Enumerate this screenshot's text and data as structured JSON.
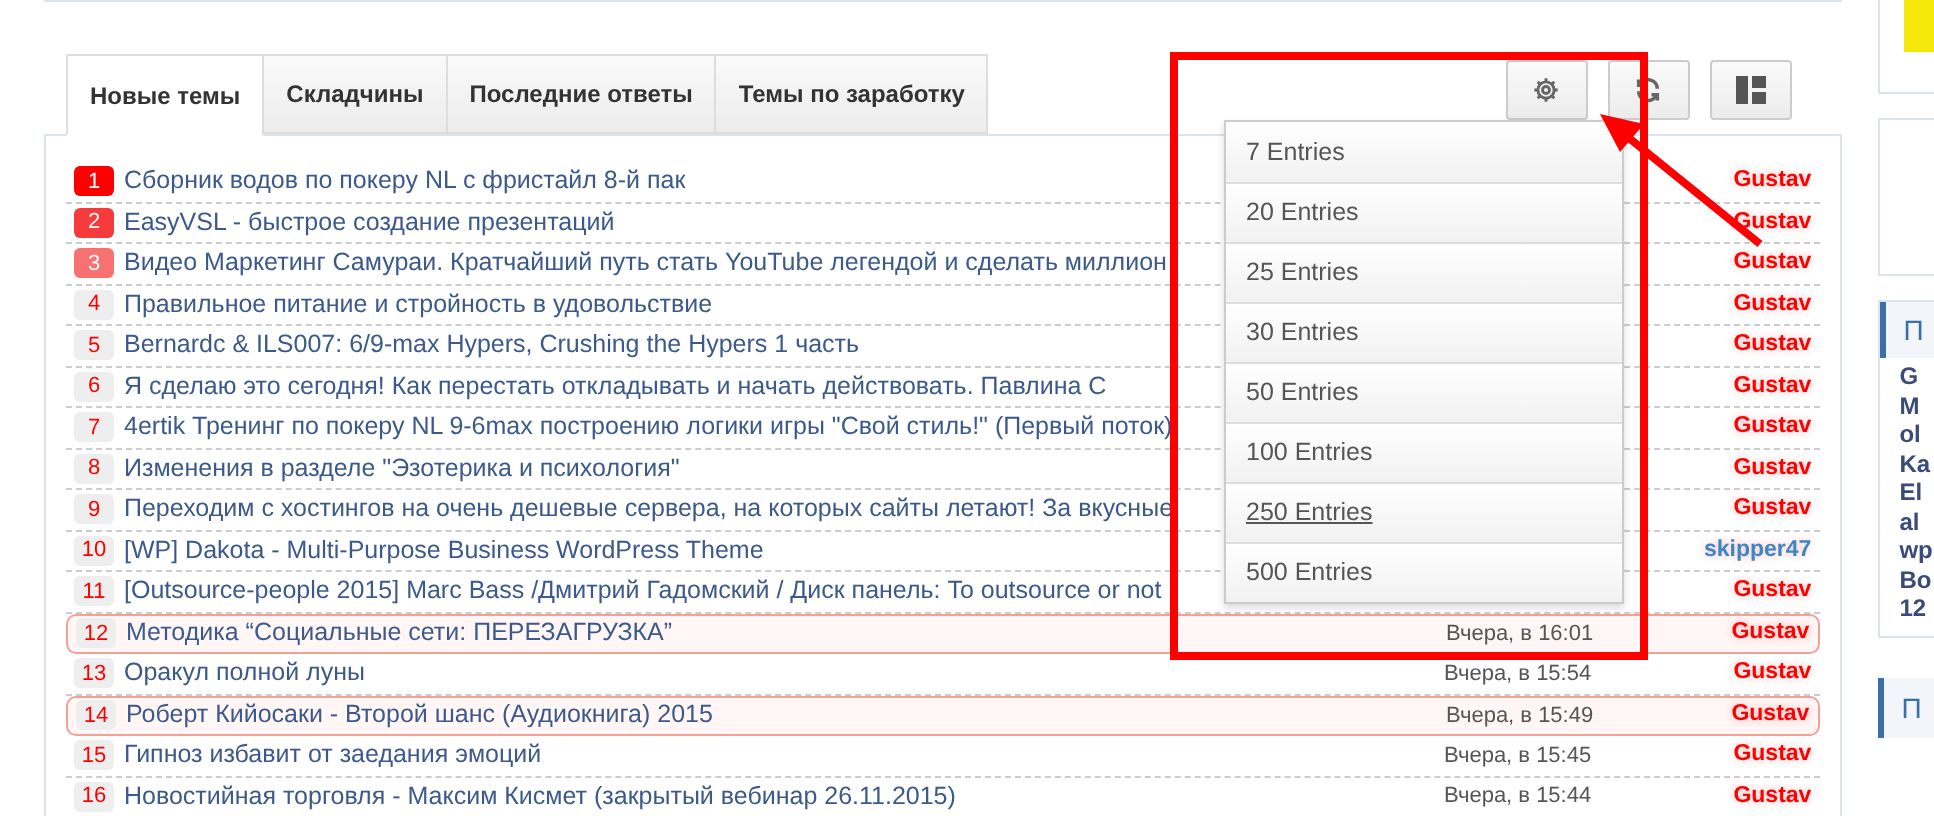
{
  "tabs": [
    {
      "label": "Новые темы",
      "selected": true
    },
    {
      "label": "Складчины",
      "selected": false
    },
    {
      "label": "Последние ответы",
      "selected": false
    },
    {
      "label": "Темы по заработку",
      "selected": false
    }
  ],
  "toolbar": [
    {
      "kind": "settings"
    },
    {
      "kind": "refresh"
    },
    {
      "kind": "layout"
    }
  ],
  "threads": [
    {
      "badge": {
        "rank": "1",
        "kind": "hot",
        "color": "#ff0000"
      },
      "title": "Сборник водов по покеру NL с фристайл 8-й пак",
      "author": {
        "name": "Gustav",
        "color": "#ff0000"
      },
      "highlighted": false
    },
    {
      "badge": {
        "rank": "2",
        "kind": "hot",
        "color": "#f53b3b"
      },
      "title": "EasyVSL - быстрое создание презентаций",
      "author": {
        "name": "Gustav",
        "color": "#ff0000"
      },
      "highlighted": false
    },
    {
      "badge": {
        "rank": "3",
        "kind": "hot",
        "color": "#f87171"
      },
      "title": "Видео Маркетинг Самураи. Кратчайший путь стать YouTube легендой и сделать миллион",
      "author": {
        "name": "Gustav",
        "color": "#ff0000"
      },
      "highlighted": false
    },
    {
      "badge": {
        "rank": "4",
        "kind": "plain"
      },
      "title": "Правильное питание и стройность в удовольствие",
      "author": {
        "name": "Gustav",
        "color": "#ff0000"
      },
      "highlighted": false
    },
    {
      "badge": {
        "rank": "5",
        "kind": "plain"
      },
      "title": "Bernardc & ILS007: 6/9-max Hypers, Crushing the Hypers 1 часть",
      "author": {
        "name": "Gustav",
        "color": "#ff0000"
      },
      "highlighted": false
    },
    {
      "badge": {
        "rank": "6",
        "kind": "plain"
      },
      "title": "Я сделаю это сегодня! Как перестать откладывать и начать действовать. Павлина С",
      "author": {
        "name": "Gustav",
        "color": "#ff0000"
      },
      "highlighted": false
    },
    {
      "badge": {
        "rank": "7",
        "kind": "plain"
      },
      "title": "4ertik Тренинг по покеру NL 9-6max построению логики игры \"Свой стиль!\" (Первый поток)",
      "author": {
        "name": "Gustav",
        "color": "#ff0000"
      },
      "highlighted": false
    },
    {
      "badge": {
        "rank": "8",
        "kind": "plain"
      },
      "title": "Изменения в разделе \"Эзотерика и психология\"",
      "author": {
        "name": "Gustav",
        "color": "#ff0000"
      },
      "highlighted": false
    },
    {
      "badge": {
        "rank": "9",
        "kind": "plain"
      },
      "title": "Переходим с хостингов на очень дешевые сервера, на которых сайты летают! За вкусные",
      "author": {
        "name": "Gustav",
        "color": "#ff0000"
      },
      "highlighted": false
    },
    {
      "badge": {
        "rank": "10",
        "kind": "plain"
      },
      "title": "[WP] Dakota - Multi-Purpose Business WordPress Theme",
      "author": {
        "name": "skipper47",
        "color": "#3a87c8"
      },
      "highlighted": false
    },
    {
      "badge": {
        "rank": "11",
        "kind": "plain"
      },
      "title": "[Outsource-people 2015] Marc Bass /Дмитрий Гадомский / Диск панель: To outsource or not",
      "author": {
        "name": "Gustav",
        "color": "#ff0000"
      },
      "highlighted": false
    },
    {
      "badge": {
        "rank": "12",
        "kind": "plain"
      },
      "title": "Методика “Социальные сети: ПЕРЕЗАГРУЗКА”",
      "date": "Вчера, в 16:01",
      "author": {
        "name": "Gustav",
        "color": "#ff0000"
      },
      "highlighted": true
    },
    {
      "badge": {
        "rank": "13",
        "kind": "plain"
      },
      "title": "Оракул полной луны",
      "date": "Вчера, в 15:54",
      "author": {
        "name": "Gustav",
        "color": "#ff0000"
      },
      "highlighted": false
    },
    {
      "badge": {
        "rank": "14",
        "kind": "plain"
      },
      "title": "Роберт Кийосаки - Второй шанс (Аудиокнига) 2015",
      "date": "Вчера, в 15:49",
      "author": {
        "name": "Gustav",
        "color": "#ff0000"
      },
      "highlighted": true
    },
    {
      "badge": {
        "rank": "15",
        "kind": "plain"
      },
      "title": "Гипноз избавит от заедания эмоций",
      "date": "Вчера, в 15:45",
      "author": {
        "name": "Gustav",
        "color": "#ff0000"
      },
      "highlighted": false
    },
    {
      "badge": {
        "rank": "16",
        "kind": "plain"
      },
      "title": "Новостийная торговля - Максим Кисмет (закрытый вебинар 26.11.2015)",
      "date": "Вчера, в 15:44",
      "author": {
        "name": "Gustav",
        "color": "#ff0000"
      },
      "highlighted": false
    }
  ],
  "entries_menu": [
    {
      "label": "7 Entries",
      "hovered": false
    },
    {
      "label": "20 Entries",
      "hovered": false
    },
    {
      "label": "25 Entries",
      "hovered": false
    },
    {
      "label": "30 Entries",
      "hovered": false
    },
    {
      "label": "50 Entries",
      "hovered": false
    },
    {
      "label": "100 Entries",
      "hovered": false
    },
    {
      "label": "250 Entries",
      "hovered": true
    },
    {
      "label": "500 Entries",
      "hovered": false
    }
  ],
  "sidebar": {
    "widget_1_title": "П",
    "widget_1_lines": [
      "G",
      "M",
      "ol",
      "Ka",
      "El",
      "al",
      "wp",
      "Во",
      "12"
    ],
    "widget_2_title": "П"
  }
}
